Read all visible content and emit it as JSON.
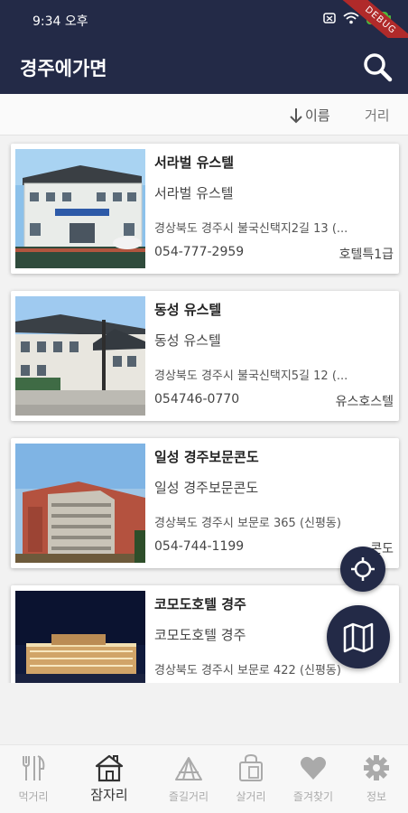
{
  "status": {
    "time": "9:34 오후",
    "battery": "100",
    "debug": "DEBUG"
  },
  "app": {
    "title": "경주에가면"
  },
  "sort": {
    "name_label": "이름",
    "distance_label": "거리"
  },
  "cards": [
    {
      "title": "서라벌 유스텔",
      "subtitle": "서라벌 유스텔",
      "address": "경상북도 경주시 불국신택지2길 13 (...",
      "phone": "054-777-2959",
      "category": "호텔특1급"
    },
    {
      "title": "동성 유스텔",
      "subtitle": "동성 유스텔",
      "address": "경상북도 경주시 불국신택지5길 12 (...",
      "phone": "054746-0770",
      "category": "유스호스텔"
    },
    {
      "title": "일성 경주보문콘도",
      "subtitle": "일성 경주보문콘도",
      "address": "경상북도 경주시 보문로 365 (신평동)",
      "phone": "054-744-1199",
      "category": "콘도"
    },
    {
      "title": "코모도호텔 경주",
      "subtitle": "코모도호텔 경주",
      "address": "경상북도 경주시 보문로 422 (신평동)",
      "phone": "",
      "category": ""
    }
  ],
  "nav": [
    {
      "label": "먹거리",
      "icon": "utensils-icon"
    },
    {
      "label": "잠자리",
      "icon": "house-icon"
    },
    {
      "label": "즐길거리",
      "icon": "tent-icon"
    },
    {
      "label": "살거리",
      "icon": "shopping-bag-icon"
    },
    {
      "label": "즐겨찾기",
      "icon": "heart-icon"
    },
    {
      "label": "정보",
      "icon": "gear-icon"
    }
  ],
  "colors": {
    "primary": "#232a47",
    "background": "#f2f2f2",
    "nav_inactive": "#aaaaaa"
  }
}
